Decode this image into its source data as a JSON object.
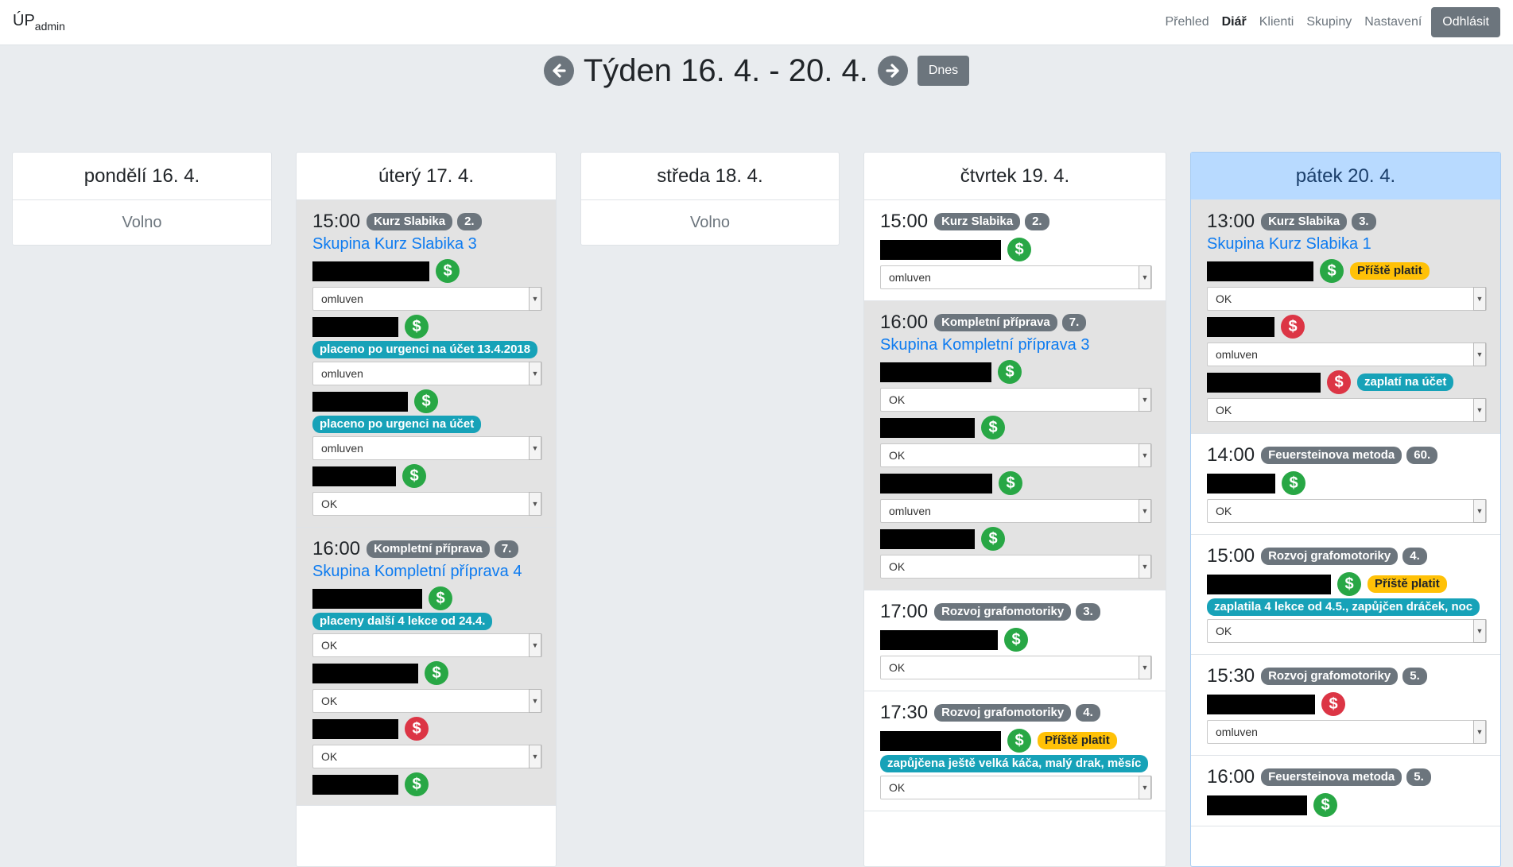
{
  "brand": {
    "main": "ÚP",
    "sub": "admin"
  },
  "nav": {
    "items": [
      "Přehled",
      "Diář",
      "Klienti",
      "Skupiny",
      "Nastavení"
    ],
    "logout": "Odhlásit"
  },
  "week": {
    "title": "Týden 16. 4. - 20. 4.",
    "today": "Dnes"
  },
  "days": [
    {
      "label": "pondělí 16. 4.",
      "free": "Volno"
    },
    {
      "label": "úterý 17. 4."
    },
    {
      "label": "středa 18. 4.",
      "free": "Volno"
    },
    {
      "label": "čtvrtek 19. 4."
    },
    {
      "label": "pátek 20. 4."
    }
  ],
  "events": {
    "tue1": {
      "time": "15:00",
      "name": "Kurz Slabika",
      "count": "2.",
      "group": "Skupina Kurz Slabika 3",
      "notes": [
        "placeno po urgenci na účet 13.4.2018",
        "placeno po urgenci na účet"
      ],
      "selects": [
        "omluven",
        "omluven",
        "omluven",
        "OK"
      ]
    },
    "tue2": {
      "time": "16:00",
      "name": "Kompletní příprava",
      "count": "7.",
      "group": "Skupina Kompletní příprava 4",
      "notes": [
        "placeny další 4 lekce od 24.4."
      ],
      "selects": [
        "OK",
        "OK",
        "OK"
      ]
    },
    "thu1": {
      "time": "15:00",
      "name": "Kurz Slabika",
      "count": "2.",
      "selects": [
        "omluven"
      ]
    },
    "thu2": {
      "time": "16:00",
      "name": "Kompletní příprava",
      "count": "7.",
      "group": "Skupina Kompletní příprava 3",
      "selects": [
        "OK",
        "OK",
        "omluven",
        "OK"
      ]
    },
    "thu3": {
      "time": "17:00",
      "name": "Rozvoj grafomotoriky",
      "count": "3.",
      "selects": [
        "OK"
      ]
    },
    "thu4": {
      "time": "17:30",
      "name": "Rozvoj grafomotoriky",
      "count": "4.",
      "warn": "Příště platit",
      "notes": [
        "zapůjčena ještě velká káča, malý drak, měsíc"
      ],
      "selects": [
        "OK"
      ]
    },
    "fri1": {
      "time": "13:00",
      "name": "Kurz Slabika",
      "count": "3.",
      "group": "Skupina Kurz Slabika 1",
      "warn": "Příště platit",
      "notes": [
        "zaplatí na účet"
      ],
      "selects": [
        "OK",
        "omluven",
        "OK"
      ]
    },
    "fri2": {
      "time": "14:00",
      "name": "Feuersteinova metoda",
      "count": "60.",
      "selects": [
        "OK"
      ]
    },
    "fri3": {
      "time": "15:00",
      "name": "Rozvoj grafomotoriky",
      "count": "4.",
      "warn": "Příště platit",
      "notes": [
        "zaplatila 4 lekce od 4.5., zapůjčen dráček, noc"
      ],
      "selects": [
        "OK"
      ]
    },
    "fri4": {
      "time": "15:30",
      "name": "Rozvoj grafomotoriky",
      "count": "5.",
      "selects": [
        "omluven"
      ]
    },
    "fri5": {
      "time": "16:00",
      "name": "Feuersteinova metoda",
      "count": "5."
    }
  },
  "icons": {
    "payment": "dollar-icon",
    "prev": "arrow-left-icon",
    "next": "arrow-right-icon"
  },
  "colors": {
    "paid": "#28a745",
    "unpaid": "#dc3545",
    "info": "#17a2b8",
    "warning": "#ffc107",
    "today": "#b8daff"
  }
}
